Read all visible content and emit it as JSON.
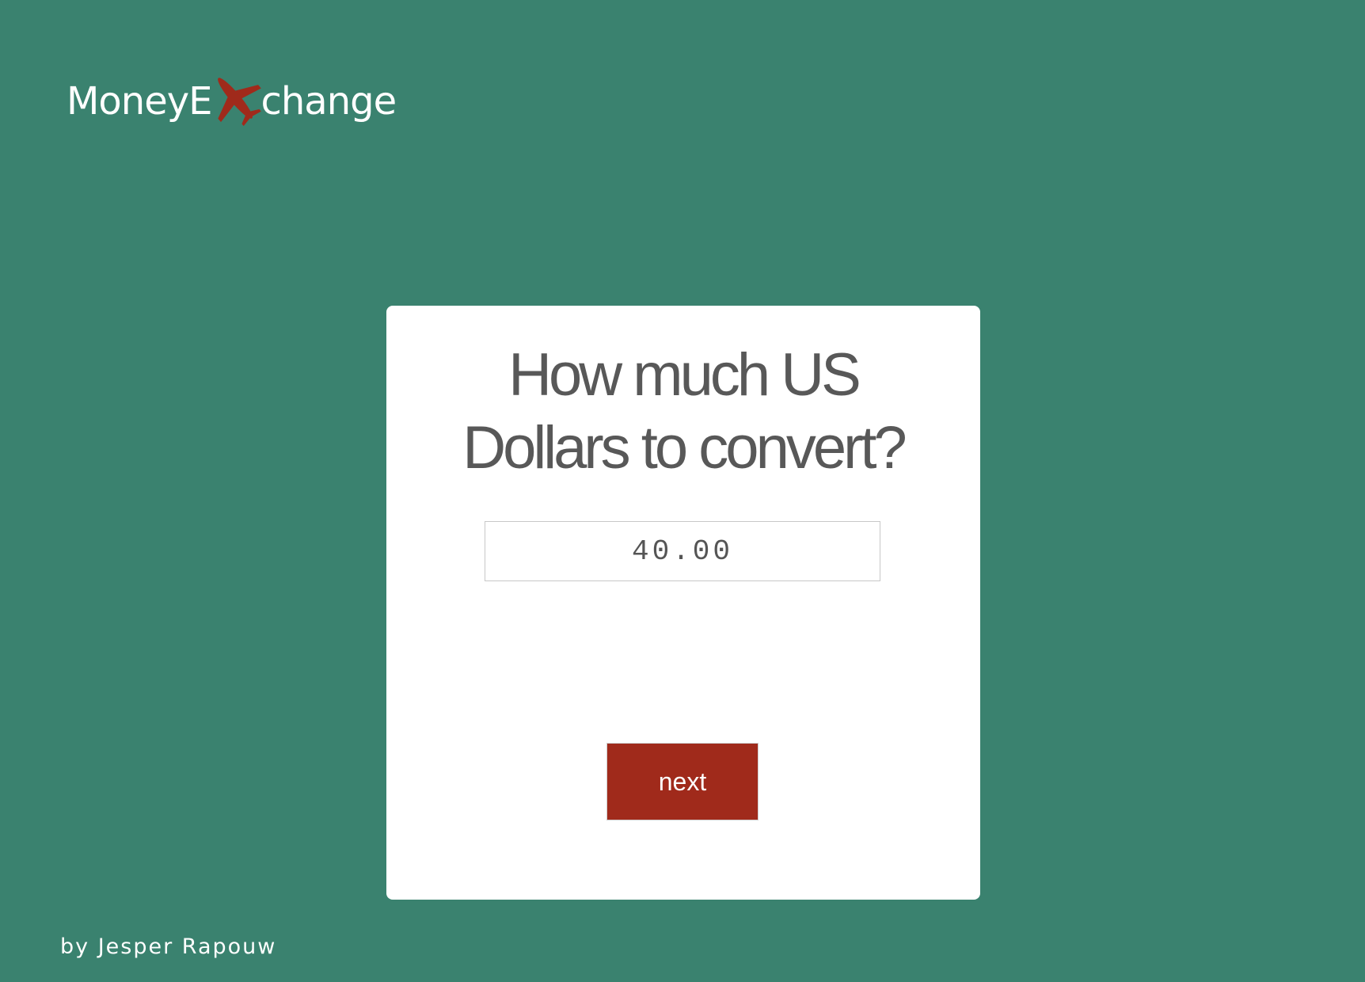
{
  "brand": {
    "name_prefix": "MoneyE",
    "name_suffix": "change",
    "plane_icon": "airplane-icon",
    "plane_color": "#a02a1b"
  },
  "card": {
    "title_line1": "How much US",
    "title_line2": "Dollars to convert?",
    "amount_value": "40.00",
    "next_label": "next"
  },
  "footer": {
    "credit": "by Jesper Rapouw"
  },
  "colors": {
    "background": "#3a826f",
    "card": "#ffffff",
    "accent": "#a02a1b",
    "text": "#585858"
  }
}
